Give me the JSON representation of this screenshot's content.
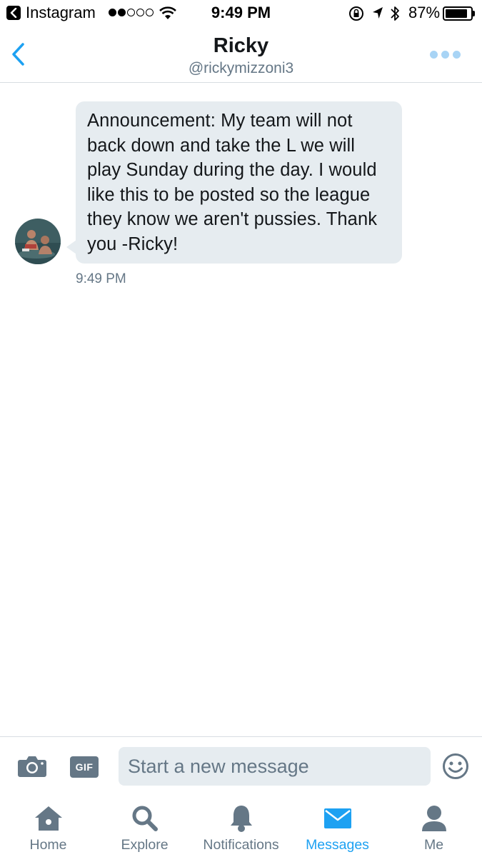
{
  "status_bar": {
    "back_app": "Instagram",
    "time": "9:49 PM",
    "battery": "87%",
    "battery_level": 0.87,
    "signal_bars": 2
  },
  "header": {
    "name": "Ricky",
    "handle": "@rickymizzoni3"
  },
  "conversation": {
    "messages": [
      {
        "text": "Announcement: My team will not back down and take the L we will play Sunday during the day. I would like this to be posted so the league they know we aren't pussies. Thank you -Ricky!",
        "time": "9:49 PM"
      }
    ]
  },
  "composer": {
    "gif_label": "GIF",
    "placeholder": "Start a new message"
  },
  "tabbar": {
    "tabs": [
      {
        "label": "Home",
        "icon": "home-icon"
      },
      {
        "label": "Explore",
        "icon": "search-icon"
      },
      {
        "label": "Notifications",
        "icon": "bell-icon"
      },
      {
        "label": "Messages",
        "icon": "envelope-icon"
      },
      {
        "label": "Me",
        "icon": "person-icon"
      }
    ],
    "active_tab": "Messages"
  },
  "colors": {
    "accent": "#1da1f2",
    "muted": "#657786",
    "bubble": "#e6ecf0",
    "more_dots": "#a8d4f5"
  }
}
